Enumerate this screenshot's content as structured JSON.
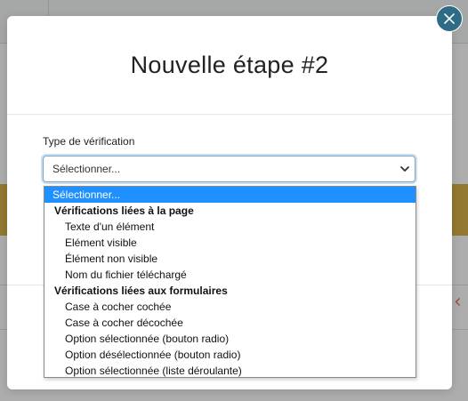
{
  "modal": {
    "title": "Nouvelle étape #2",
    "close_icon": "close-icon",
    "field_label": "Type de vérification",
    "select": {
      "selected_value": "Sélectionner..."
    }
  },
  "dropdown": {
    "placeholder_option": "Sélectionner...",
    "groups": [
      {
        "label": "Vérifications liées à la page",
        "options": [
          "Texte d'un élément",
          "Elément visible",
          "Élément non visible",
          "Nom du fichier téléchargé"
        ]
      },
      {
        "label": "Vérifications liées aux formulaires",
        "options": [
          "Case à cocher cochée",
          "Case à cocher décochée",
          "Option sélectionnée (bouton radio)",
          "Option désélectionnée (bouton radio)",
          "Option sélectionnée (liste déroulante)"
        ]
      }
    ]
  },
  "colors": {
    "accent": "#2d6b86",
    "selection": "#1e90ff",
    "background_band": "#d9b24a"
  }
}
